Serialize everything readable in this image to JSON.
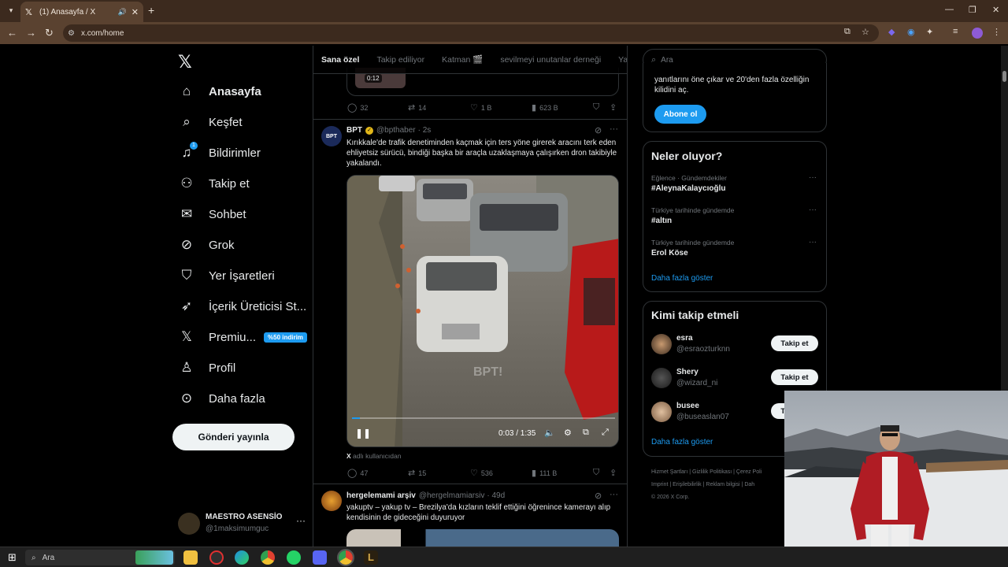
{
  "browser": {
    "tab_title": "(1) Anasayfa / X",
    "url": "x.com/home"
  },
  "nav": {
    "items": [
      {
        "label": "Anasayfa",
        "icon": "home-icon",
        "active": true
      },
      {
        "label": "Keşfet",
        "icon": "search-icon"
      },
      {
        "label": "Bildirimler",
        "icon": "bell-icon",
        "badge": "1"
      },
      {
        "label": "Takip et",
        "icon": "add-user-icon"
      },
      {
        "label": "Sohbet",
        "icon": "mail-icon"
      },
      {
        "label": "Grok",
        "icon": "grok-icon"
      },
      {
        "label": "Yer İşaretleri",
        "icon": "bookmark-icon"
      },
      {
        "label": "İçerik Üreticisi St...",
        "icon": "rocket-icon"
      },
      {
        "label": "Premiu...",
        "icon": "x-logo-icon",
        "promo": "%50 indirim"
      },
      {
        "label": "Profil",
        "icon": "person-icon"
      },
      {
        "label": "Daha fazla",
        "icon": "more-circle-icon"
      }
    ],
    "post_button": "Gönderi yayınla",
    "account": {
      "name": "MAESTRO ASENSİO",
      "handle": "@1maksimumguc"
    }
  },
  "timeline": {
    "tabs": [
      "Sana özel",
      "Takip ediliyor",
      "Katman 🎬",
      "sevilmeyi unutanlar derneği",
      "Ya"
    ],
    "prev_tweet": {
      "video_time": "0:12",
      "replies": "32",
      "reposts": "14",
      "likes": "1 B",
      "views": "623 B"
    },
    "tweet1": {
      "name": "BPT",
      "handle": "@bpthaber",
      "time": "· 2s",
      "avatar_text": "BPT",
      "text": "Kırıkkale'de trafik denetiminden kaçmak için ters yöne girerek aracını terk eden ehliyetsiz sürücü, bindiği başka bir araçla uzaklaşmaya çalışırken dron takibiyle yakalandı.",
      "video_watermark": "BPT!",
      "video_time": "0:03 / 1:35",
      "video_progress": 0.03,
      "source_label": "X",
      "source_text": "adlı kullanıcıdan",
      "replies": "47",
      "reposts": "15",
      "likes": "536",
      "views": "111 B"
    },
    "tweet2": {
      "name": "hergelemami arşiv",
      "handle": "@hergelmamiarsiv",
      "time": "· 49d",
      "text": "yakuptv – yakup tv – Brezilya'da kızların teklif ettiğini öğrenince kamerayı alıp kendisinin de gideceğini duyuruyor"
    }
  },
  "right": {
    "search_placeholder": "Ara",
    "premium_text_1": "yanıtlarını öne çıkar ve 20'den fazla özelliğin",
    "premium_text_2": "kilidini aç.",
    "subscribe": "Abone ol",
    "trends_title": "Neler oluyor?",
    "trends": [
      {
        "meta": "Eğlence · Gündemdekiler",
        "name": "#AleynaKalaycıoğlu"
      },
      {
        "meta": "Türkiye tarihinde gündemde",
        "name": "#altın"
      },
      {
        "meta": "Türkiye tarihinde gündemde",
        "name": "Erol Köse"
      }
    ],
    "show_more": "Daha fazla göster",
    "who_title": "Kimi takip etmeli",
    "who": [
      {
        "name": "esra",
        "handle": "@esraozturknn",
        "btn": "Takip et"
      },
      {
        "name": "Shery",
        "handle": "@wizard_ni",
        "btn": "Takip et"
      },
      {
        "name": "busee",
        "handle": "@buseaslan07",
        "btn": "Takip et"
      }
    ],
    "footer": [
      "Hizmet Şartları",
      "Gizlilik Politikası",
      "Çerez Poli",
      "Imprint",
      "Erişilebilirlik",
      "Reklam bilgisi",
      "Dah",
      "© 2026 X Corp."
    ]
  },
  "taskbar": {
    "search": "Ara"
  },
  "colors": {
    "accent": "#1d9bf0",
    "chrome": "#5a4230",
    "bg": "#000000"
  }
}
